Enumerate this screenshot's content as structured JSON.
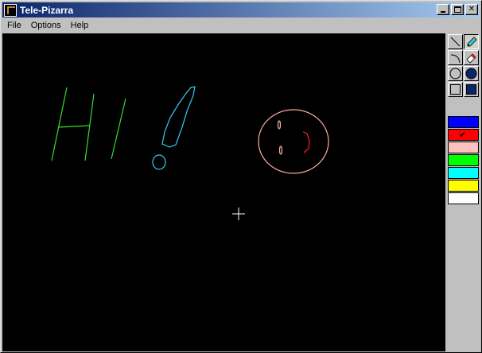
{
  "window": {
    "title": "Tele-Pizarra"
  },
  "title_buttons": {
    "close_glyph": "✕"
  },
  "menu": {
    "items": [
      "File",
      "Options",
      "Help"
    ]
  },
  "toolbox": {
    "tools": [
      "line-tool",
      "pencil-tool",
      "arc-tool",
      "eraser-tool",
      "circle-tool",
      "filled-circle-tool",
      "rectangle-tool",
      "filled-rectangle-tool"
    ],
    "active_tool": "pencil-tool",
    "colors": [
      "#0000ff",
      "#ff0000",
      "#ffc0c0",
      "#00ff00",
      "#00ffff",
      "#ffff00",
      "#ffffff"
    ],
    "selected_color": "#ff0000",
    "check_glyph": "✔"
  },
  "drawing": {
    "colors": {
      "green": "#33dd33",
      "cyan": "#33ccee",
      "pink": "#ffb0a0",
      "red": "#ff2020",
      "cursor": "#ffffff"
    }
  }
}
